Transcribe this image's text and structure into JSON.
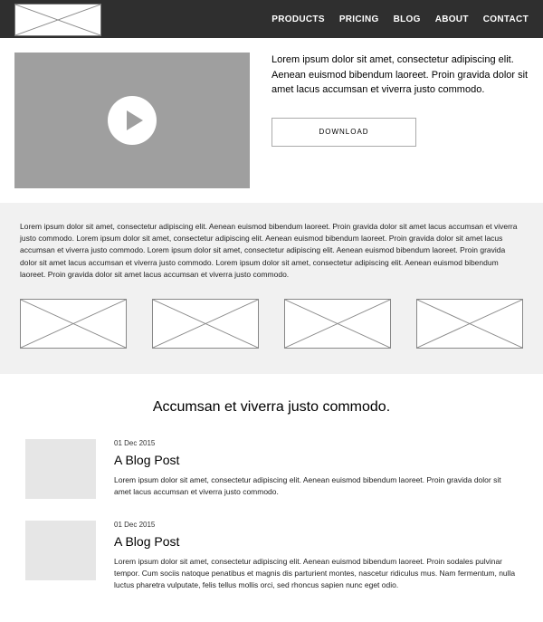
{
  "nav": {
    "items": [
      "PRODUCTS",
      "PRICING",
      "BLOG",
      "ABOUT",
      "CONTACT"
    ]
  },
  "hero": {
    "text": "Lorem ipsum dolor sit amet, consectetur adipiscing elit. Aenean euismod bibendum laoreet. Proin gravida dolor sit amet lacus accumsan et viverra justo commodo.",
    "download_label": "DOWNLOAD"
  },
  "strip": {
    "text": "Lorem ipsum dolor sit amet, consectetur adipiscing elit. Aenean euismod bibendum laoreet. Proin gravida dolor sit amet lacus accumsan et viverra justo commodo. Lorem ipsum dolor sit amet, consectetur adipiscing elit. Aenean euismod bibendum laoreet. Proin gravida dolor sit amet lacus accumsan et viverra justo commodo. Lorem ipsum dolor sit amet, consectetur adipiscing elit. Aenean euismod bibendum laoreet. Proin gravida dolor sit amet lacus accumsan et viverra justo commodo. Lorem ipsum dolor sit amet, consectetur adipiscing elit. Aenean euismod bibendum laoreet. Proin gravida dolor sit amet lacus accumsan et viverra justo commodo."
  },
  "blog": {
    "heading": "Accumsan et viverra justo commodo.",
    "posts": [
      {
        "date": "01 Dec 2015",
        "title": "A Blog Post",
        "excerpt": "Lorem ipsum dolor sit amet, consectetur adipiscing elit. Aenean euismod bibendum laoreet. Proin gravida dolor sit amet lacus accumsan et viverra justo commodo."
      },
      {
        "date": "01 Dec 2015",
        "title": "A Blog Post",
        "excerpt": "Lorem ipsum dolor sit amet, consectetur adipiscing elit. Aenean euismod bibendum laoreet. Proin sodales pulvinar tempor. Cum sociis natoque penatibus et magnis dis parturient montes, nascetur ridiculus mus. Nam fermentum, nulla luctus pharetra vulputate, felis tellus mollis orci, sed rhoncus sapien nunc eget odio."
      }
    ]
  }
}
